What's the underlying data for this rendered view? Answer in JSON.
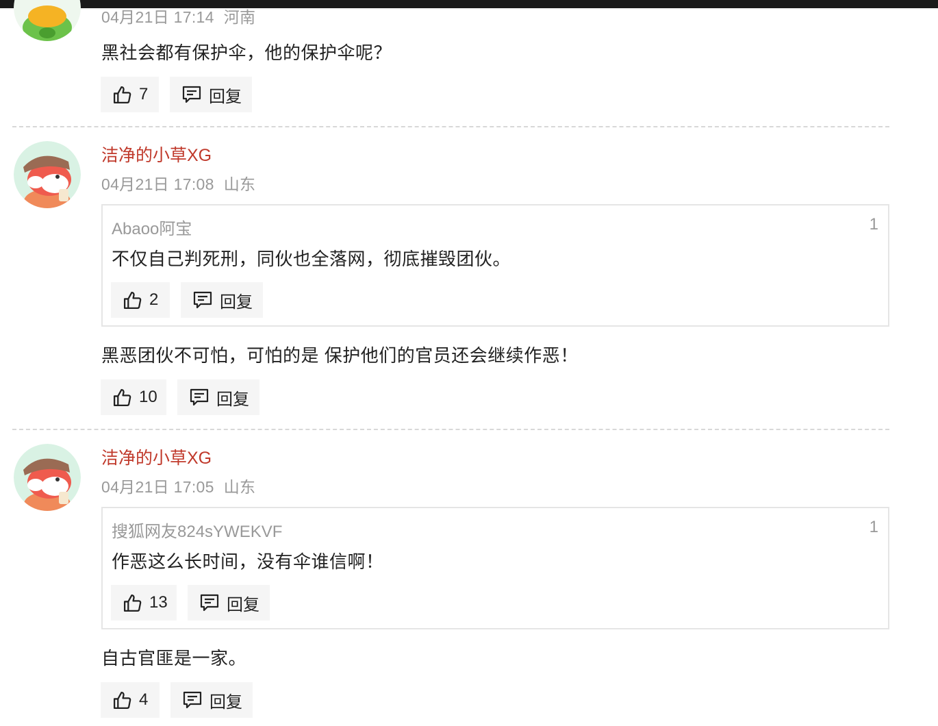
{
  "comments": [
    {
      "time": "04月21日 17:14",
      "location": "河南",
      "text": "黑社会都有保护伞，他的保护伞呢？",
      "likes": "7",
      "reply_label": "回复"
    },
    {
      "user": "洁净的小草XG",
      "time": "04月21日 17:08",
      "location": "山东",
      "quote": {
        "user": "Abaoo阿宝",
        "floor": "1",
        "text": "不仅自己判死刑，同伙也全落网，彻底摧毁团伙。",
        "likes": "2",
        "reply_label": "回复"
      },
      "text": "黑恶团伙不可怕，可怕的是 保护他们的官员还会继续作恶！",
      "likes": "10",
      "reply_label": "回复"
    },
    {
      "user": "洁净的小草XG",
      "time": "04月21日 17:05",
      "location": "山东",
      "quote": {
        "user": "搜狐网友824sYWEKVF",
        "floor": "1",
        "text": "作恶这么长时间，没有伞谁信啊！",
        "likes": "13",
        "reply_label": "回复"
      },
      "text": "自古官匪是一家。",
      "likes": "4",
      "reply_label": "回复"
    }
  ],
  "colors": {
    "username": "#c0392b",
    "meta": "#999999",
    "button_bg": "#f5f5f5",
    "divider": "#d8d8d8"
  },
  "icons": {
    "like": "thumbs-up-icon",
    "reply": "comment-icon"
  }
}
